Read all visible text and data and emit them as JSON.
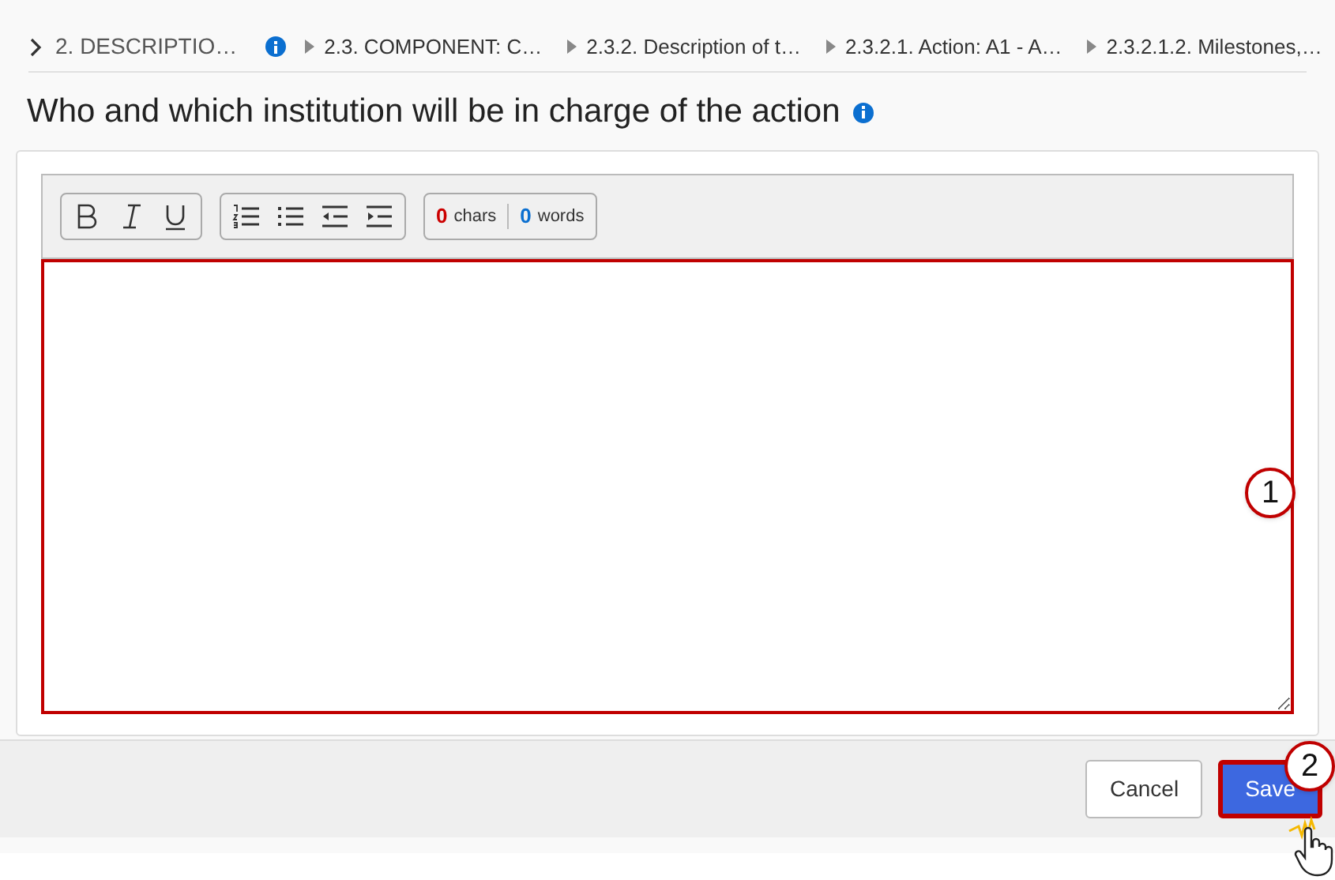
{
  "breadcrumb": [
    {
      "label": "2. DESCRIPTIO…",
      "kind": "root"
    },
    {
      "label": "2.3. COMPONENT: C…",
      "kind": "step"
    },
    {
      "label": "2.3.2. Description of t…",
      "kind": "step"
    },
    {
      "label": "2.3.2.1. Action: A1 - A…",
      "kind": "step"
    },
    {
      "label": "2.3.2.1.2. Milestones,…",
      "kind": "step"
    }
  ],
  "heading": "Who and which institution will be in charge of the action",
  "editor": {
    "toolbar": [
      {
        "tools": [
          {
            "kind": "bold"
          },
          {
            "kind": "italic"
          },
          {
            "kind": "underline"
          }
        ]
      },
      {
        "tools": [
          {
            "kind": "numbered"
          },
          {
            "kind": "bulleted"
          },
          {
            "kind": "outdent"
          },
          {
            "kind": "indent"
          }
        ]
      }
    ],
    "chars_count": "0",
    "chars_label": "chars",
    "words_count": "0",
    "words_label": "words",
    "invalid": true
  },
  "buttons": [
    {
      "label": "Cancel",
      "kind": "secondary",
      "highlighted": false
    },
    {
      "label": "Save",
      "kind": "primary",
      "highlighted": true
    }
  ],
  "callouts": [
    "1",
    "2"
  ]
}
